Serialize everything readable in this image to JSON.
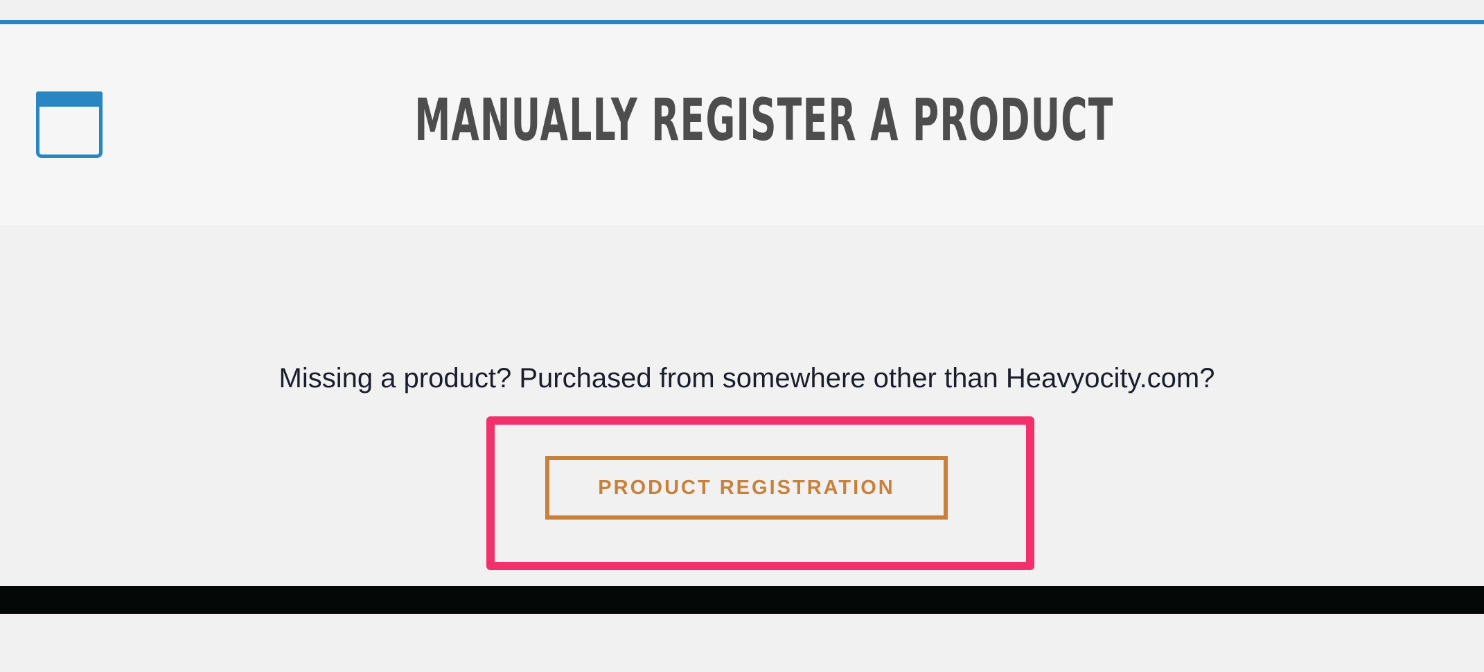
{
  "header": {
    "title": "MANUALLY REGISTER A PRODUCT",
    "icon": "window-icon"
  },
  "main": {
    "prompt": "Missing a product? Purchased from somewhere other than Heavyocity.com?",
    "register_button_label": "PRODUCT REGISTRATION"
  },
  "colors": {
    "accent_blue": "#2a86c3",
    "button_orange": "#c9803b",
    "highlight_pink": "#f2306b",
    "title_gray": "#4d4d4d",
    "footer_black": "#030807"
  }
}
